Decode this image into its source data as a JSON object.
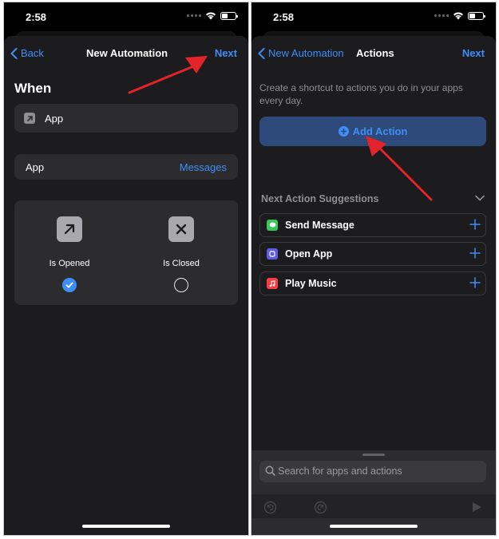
{
  "left_screen": {
    "status": {
      "time": "2:58"
    },
    "nav": {
      "back_label": "Back",
      "title": "New Automation",
      "next_label": "Next"
    },
    "when_heading": "When",
    "trigger_row": {
      "label": "App"
    },
    "app_row": {
      "label": "App",
      "value": "Messages"
    },
    "options": [
      {
        "label": "Is Opened",
        "selected": true,
        "icon": "arrow-up-right-icon"
      },
      {
        "label": "Is Closed",
        "selected": false,
        "icon": "x-icon"
      }
    ]
  },
  "right_screen": {
    "status": {
      "time": "2:58"
    },
    "nav": {
      "back_label": "New Automation",
      "title": "Actions",
      "next_label": "Next"
    },
    "description": "Create a shortcut to actions you do in your apps every day.",
    "add_action_label": "Add Action",
    "suggestions": {
      "title": "Next Action Suggestions",
      "items": [
        {
          "label": "Send Message",
          "icon": "messages-icon",
          "color": "#34c759"
        },
        {
          "label": "Open App",
          "icon": "open-app-icon",
          "color": "#5e5ce6"
        },
        {
          "label": "Play Music",
          "icon": "music-icon",
          "color": "#fc3c44"
        }
      ]
    },
    "search": {
      "placeholder": "Search for apps and actions"
    }
  },
  "colors": {
    "accent": "#3f8ef7",
    "annotation_arrow": "#e3232a",
    "sheet_bg": "#1c1c1e",
    "cell_bg": "#2c2c2e"
  }
}
